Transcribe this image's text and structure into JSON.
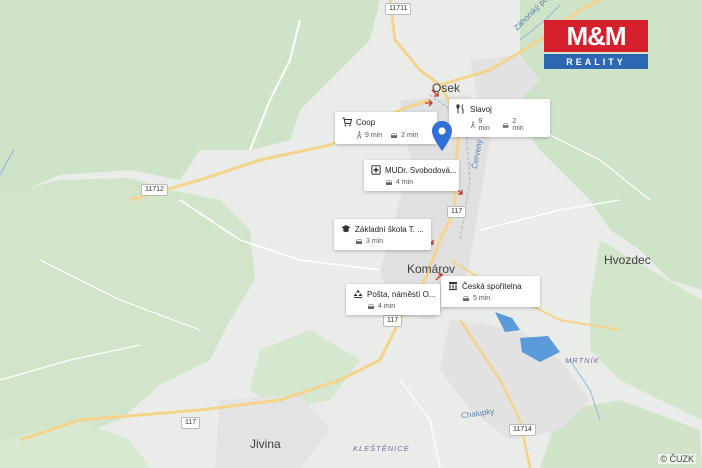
{
  "map": {
    "towns": {
      "osek": "Osek",
      "komarov": "Komárov",
      "hvozdec": "Hvozdec",
      "jivina": "Jivina"
    },
    "localities": {
      "mrtnik": "MRTNÍK",
      "klestenice": "KLEŠTĚNICE"
    },
    "features": {
      "stream1": "Chalupky",
      "stream2": "Záhorský potok",
      "street": "Červený potok"
    },
    "roads": {
      "r11711": "11711",
      "r11712": "11712",
      "r117a": "117",
      "r117b": "117",
      "r117c": "117",
      "r11714": "11714"
    },
    "copyright": "© ČUZK"
  },
  "logo": {
    "top": "M&M",
    "bottom": "REALITY"
  },
  "pois": [
    {
      "key": "coop",
      "name": "Coop",
      "icon": "cart-icon",
      "walk": "9 min",
      "car": "2 min"
    },
    {
      "key": "slavoj",
      "name": "Slavoj",
      "icon": "restaurant-icon",
      "walk": "9 min",
      "car": "2 min"
    },
    {
      "key": "mudr",
      "name": "MUDr. Svobodová...",
      "icon": "medical-icon",
      "car": "4 min"
    },
    {
      "key": "skola",
      "name": "Základní škola T. ...",
      "icon": "school-icon",
      "car": "3 min"
    },
    {
      "key": "banka",
      "name": "Česká spořitelna",
      "icon": "bank-icon",
      "car": "5 min"
    },
    {
      "key": "posta",
      "name": "Pošta, náměstí O...",
      "icon": "post-icon",
      "car": "4 min"
    }
  ],
  "colors": {
    "forest": "#cfe3c8",
    "road": "#f5d38a",
    "water": "#5b9ad8",
    "pin": "#2f6fd6"
  }
}
